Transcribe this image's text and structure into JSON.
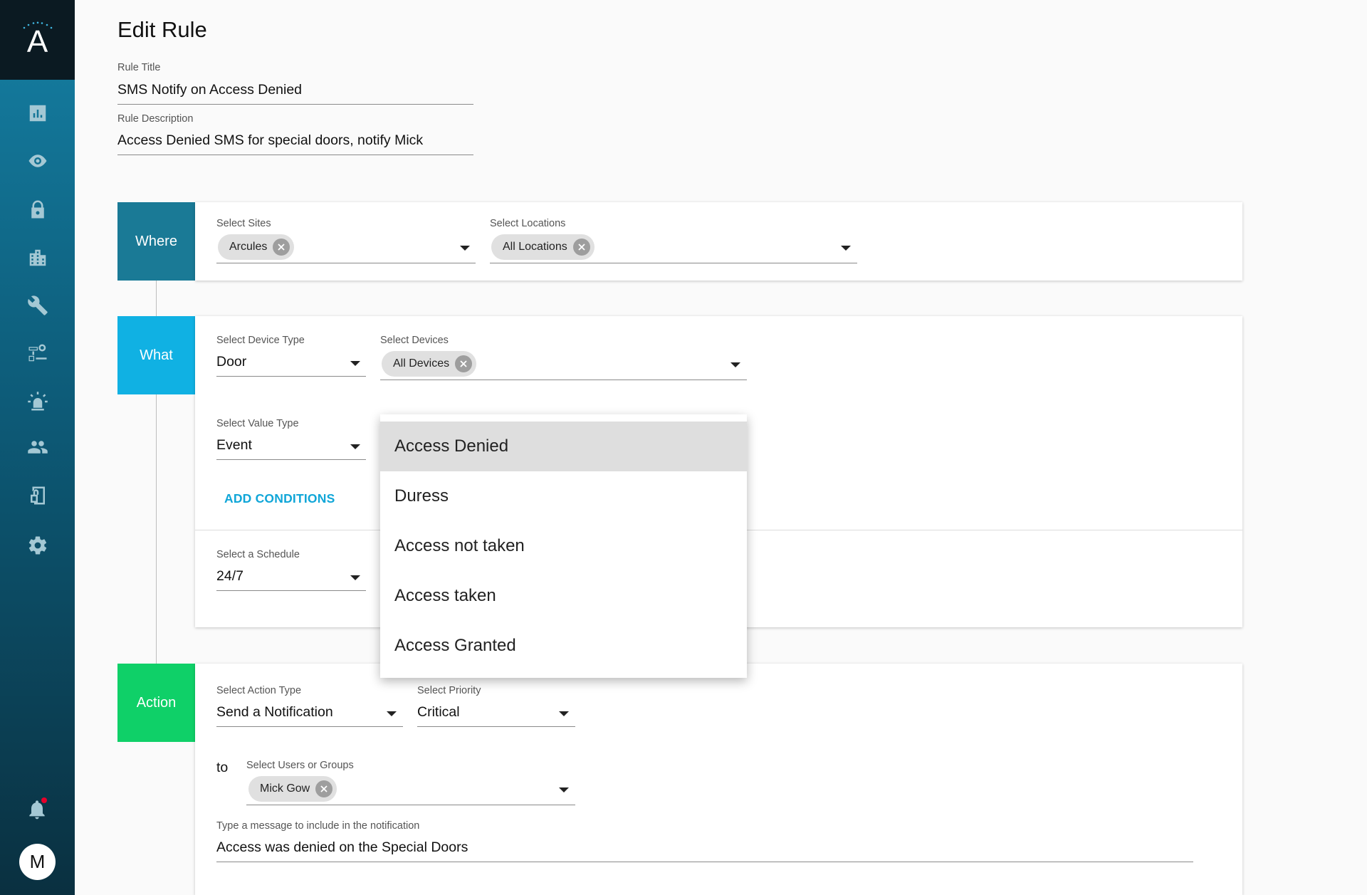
{
  "sidebar": {
    "logo_letter": "A",
    "nav": [
      {
        "name": "dashboard-icon"
      },
      {
        "name": "eye-icon"
      },
      {
        "name": "lock-icon"
      },
      {
        "name": "building-icon"
      },
      {
        "name": "wrench-icon"
      },
      {
        "name": "rules-icon"
      },
      {
        "name": "alarm-icon"
      },
      {
        "name": "people-icon"
      },
      {
        "name": "door-icon"
      },
      {
        "name": "gear-icon"
      }
    ],
    "avatar_initial": "M"
  },
  "page": {
    "title": "Edit Rule",
    "rule_title": {
      "label": "Rule Title",
      "value": "SMS Notify on Access Denied"
    },
    "rule_description": {
      "label": "Rule Description",
      "value": "Access Denied SMS for special doors, notify Mick"
    }
  },
  "where": {
    "tag": "Where",
    "sites": {
      "label": "Select Sites",
      "chip": "Arcules"
    },
    "locations": {
      "label": "Select Locations",
      "chip": "All Locations"
    }
  },
  "what": {
    "tag": "What",
    "device_type": {
      "label": "Select Device Type",
      "value": "Door"
    },
    "devices": {
      "label": "Select Devices",
      "chip": "All Devices"
    },
    "value_type": {
      "label": "Select Value Type",
      "value": "Event"
    },
    "add_conditions": "ADD CONDITIONS",
    "schedule": {
      "label": "Select a Schedule",
      "value": "24/7"
    }
  },
  "dropdown": {
    "options": [
      "Access Denied",
      "Duress",
      "Access not taken",
      "Access taken",
      "Access Granted"
    ],
    "selected": "Access Denied"
  },
  "action": {
    "tag": "Action",
    "action_type": {
      "label": "Select Action Type",
      "value": "Send a Notification"
    },
    "priority": {
      "label": "Select Priority",
      "value": "Critical"
    },
    "to_label": "to",
    "users": {
      "label": "Select Users or Groups",
      "chip": "Mick Gow"
    },
    "message": {
      "label": "Type a message to include in the notification",
      "value": "Access was denied on the Special Doors"
    }
  },
  "colors": {
    "where": "#1a7a96",
    "what": "#10b1e3",
    "action": "#0fd068",
    "link": "#10a6d8"
  }
}
